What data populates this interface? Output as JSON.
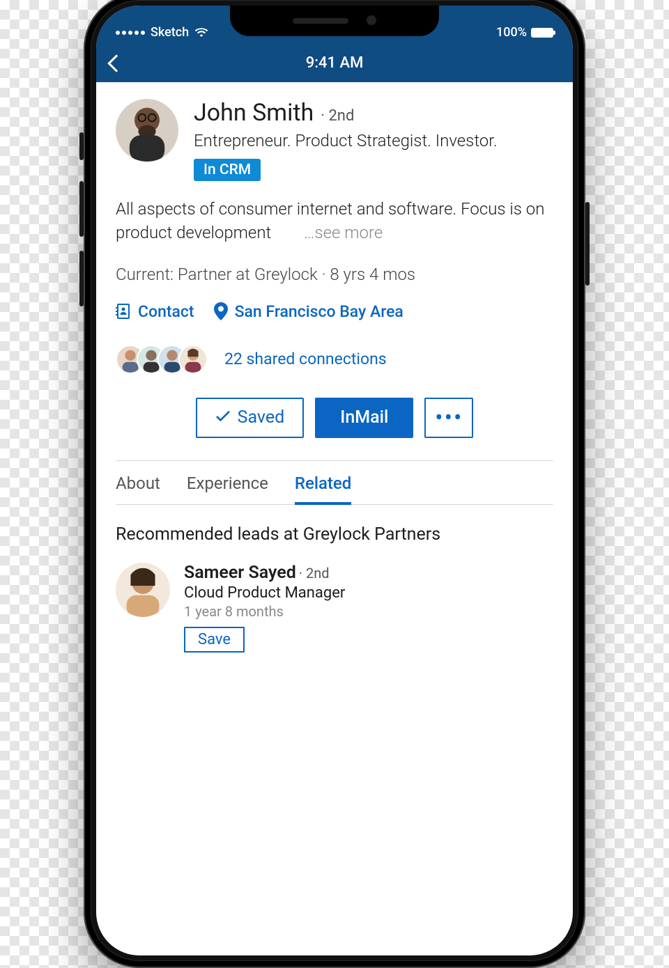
{
  "status": {
    "carrier": "Sketch",
    "battery_pct": "100%",
    "time": "9:41 AM"
  },
  "profile": {
    "name": "John Smith",
    "degree_separator": "·",
    "degree": "2nd",
    "headline": "Entrepreneur. Product Strategist. Investor.",
    "crm_badge": "In CRM",
    "summary": "All aspects of consumer internet and software. Focus is on product development",
    "see_more": "…see more",
    "current": "Current: Partner at Greylock  ·  8 yrs 4 mos",
    "contact_label": "Contact",
    "location": "San Francisco Bay Area",
    "shared_connections": "22 shared connections"
  },
  "actions": {
    "saved": "Saved",
    "inmail": "InMail",
    "more": "•••"
  },
  "tabs": {
    "about": "About",
    "experience": "Experience",
    "related": "Related"
  },
  "recommended": {
    "heading": "Recommended leads at Greylock Partners",
    "lead": {
      "name": "Sameer Sayed",
      "degree": "2nd",
      "role": "Cloud Product Manager",
      "tenure": "1 year 8 months",
      "save": "Save"
    }
  }
}
